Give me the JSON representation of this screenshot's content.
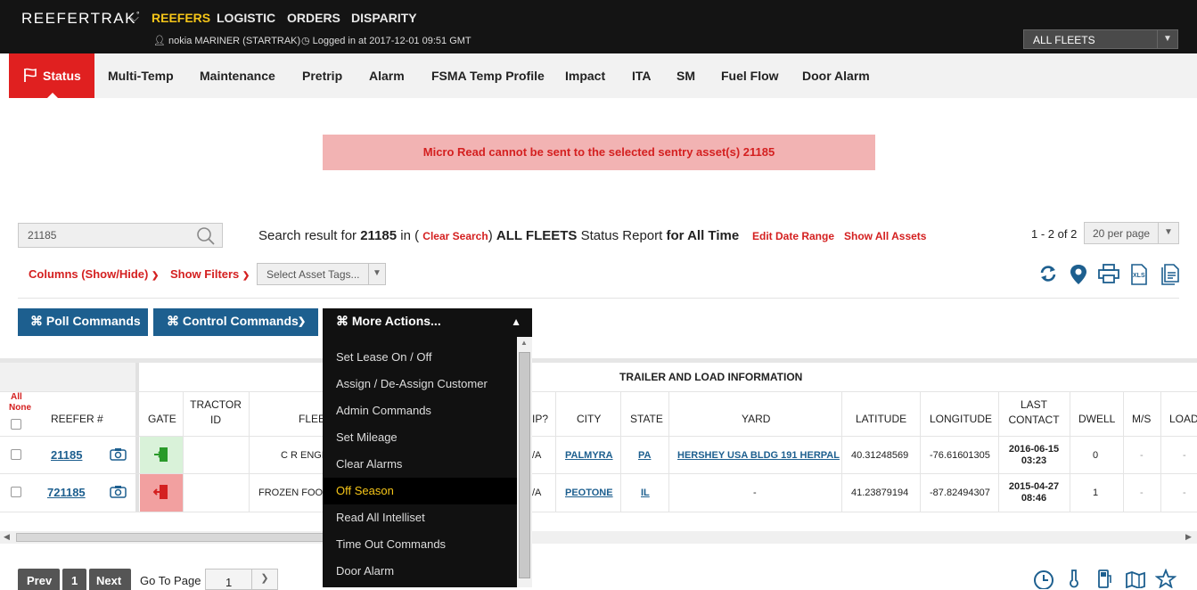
{
  "brand": "REEFERTRAK",
  "brand_mark": "°",
  "topnav": [
    "REEFERS",
    "LOGISTIC",
    "ORDERS",
    "DISPARITY"
  ],
  "user": "nokia MARINER (STARTRAK)",
  "login": "Logged in at 2017-12-01 09:51 GMT",
  "fleet_select": "ALL FLEETS",
  "tabs": [
    "Status",
    "Multi-Temp",
    "Maintenance",
    "Pretrip",
    "Alarm",
    "FSMA Temp Profile",
    "Impact",
    "ITA",
    "SM",
    "Fuel Flow",
    "Door Alarm"
  ],
  "alert": "Micro Read cannot be sent to the selected sentry asset(s) 21185",
  "search": {
    "value": "21185",
    "prefix": "Search result for ",
    "term": "21185",
    "in_open": " in ( ",
    "clear": "Clear Search",
    "close": ") ",
    "fleet": "ALL FLEETS",
    "report": " Status Report ",
    "for_time": "for All Time",
    "edit_date": "Edit Date Range",
    "show_all": "Show All Assets"
  },
  "pager": {
    "count": "1 - 2 of 2",
    "per_page": "20 per page"
  },
  "filters": {
    "columns": "Columns (Show/Hide)",
    "show_filters": "Show Filters",
    "tags_placeholder": "Select Asset Tags..."
  },
  "commands": {
    "poll": "⌘ Poll Commands",
    "control": "⌘ Control Commands",
    "more": "⌘ More Actions..."
  },
  "more_actions": [
    "Set Lease On / Off",
    "Assign / De-Assign Customer",
    "Admin Commands",
    "Set Mileage",
    "Clear Alarms",
    "Off Season",
    "Read All Intelliset",
    "Time Out Commands",
    "Door Alarm"
  ],
  "table": {
    "group_title": "TRAILER AND LOAD INFORMATION",
    "all": "All",
    "none": "None",
    "headers": {
      "reefer": "REEFER #",
      "gate": "GATE",
      "tractor": "TRACTOR ID",
      "fleet": "FLEET",
      "trip": "IP?",
      "city": "CITY",
      "state": "STATE",
      "yard": "YARD",
      "lat": "LATITUDE",
      "lon": "LONGITUDE",
      "last": "LAST CONTACT",
      "dwell": "DWELL",
      "ms": "M/S",
      "load": "LOAD"
    },
    "rows": [
      {
        "reefer": "21185",
        "fleet": "C R ENGL",
        "trip": "/A",
        "city": "PALMYRA",
        "state": "PA",
        "yard": "HERSHEY USA BLDG 191 HERPAL",
        "lat": "40.31248569",
        "lon": "-76.61601305",
        "date": "2016-06-15",
        "time": "03:23",
        "dwell": "0",
        "ms": "-",
        "load": "-",
        "gate_color": "#d9f2d9",
        "gate_icon_color": "#2a9a2a"
      },
      {
        "reefer": "721185",
        "fleet": "FROZEN FOOD",
        "trip": "/A",
        "city": "PEOTONE",
        "state": "IL",
        "yard": "-",
        "lat": "41.23879194",
        "lon": "-87.82494307",
        "date": "2015-04-27",
        "time": "08:46",
        "dwell": "1",
        "ms": "-",
        "load": "-",
        "gate_color": "#f2a0a0",
        "gate_icon_color": "#d42020"
      }
    ]
  },
  "bottom_pager": {
    "prev": "Prev",
    "page": "1",
    "next": "Next",
    "goto": "Go To Page",
    "goto_value": "1"
  }
}
